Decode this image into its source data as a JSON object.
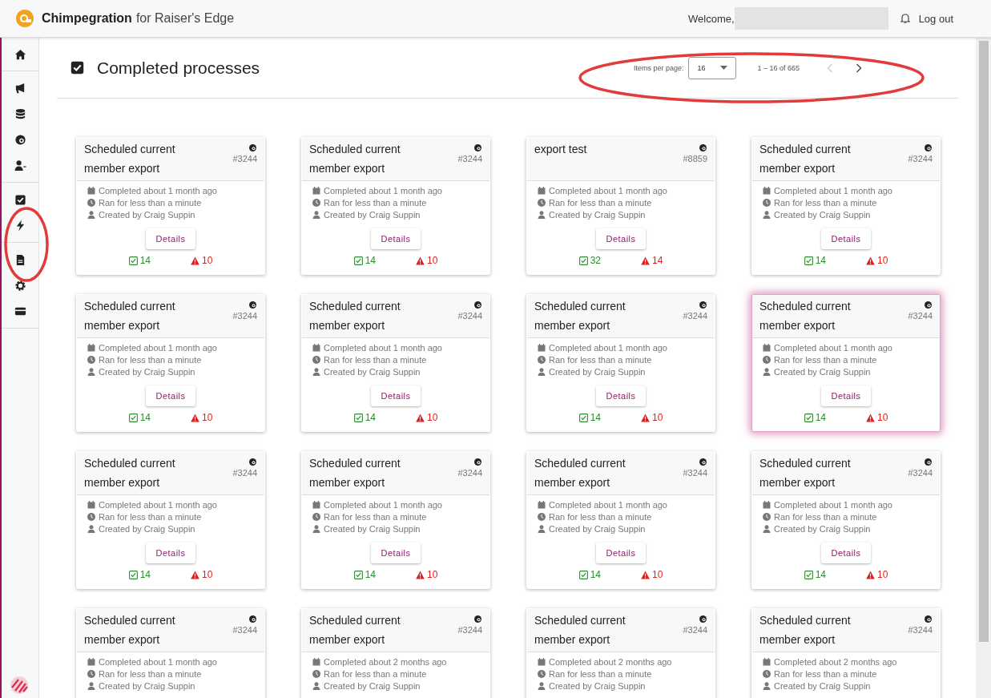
{
  "app": {
    "name": "Chimpegration",
    "suffix": "for Raiser's Edge",
    "welcome": "Welcome,",
    "logout": "Log out"
  },
  "page": {
    "title": "Completed processes"
  },
  "paginator": {
    "label": "Items per page:",
    "page_size": "16",
    "range": "1 – 16 of 665",
    "prev_disabled": true,
    "next_disabled": false
  },
  "cards": [
    {
      "title": "Scheduled current member export",
      "id": "#3244",
      "completed": "Completed about 1 month ago",
      "duration": "Ran for less than a minute",
      "creator": "Created by Craig Suppin",
      "button": "Details",
      "ok": "14",
      "warn": "10",
      "highlighted": false
    },
    {
      "title": "Scheduled current member export",
      "id": "#3244",
      "completed": "Completed about 1 month ago",
      "duration": "Ran for less than a minute",
      "creator": "Created by Craig Suppin",
      "button": "Details",
      "ok": "14",
      "warn": "10",
      "highlighted": false
    },
    {
      "title": "export test",
      "id": "#8859",
      "completed": "Completed about 1 month ago",
      "duration": "Ran for less than a minute",
      "creator": "Created by Craig Suppin",
      "button": "Details",
      "ok": "32",
      "warn": "14",
      "highlighted": false
    },
    {
      "title": "Scheduled current member export",
      "id": "#3244",
      "completed": "Completed about 1 month ago",
      "duration": "Ran for less than a minute",
      "creator": "Created by Craig Suppin",
      "button": "Details",
      "ok": "14",
      "warn": "10",
      "highlighted": false
    },
    {
      "title": "Scheduled current member export",
      "id": "#3244",
      "completed": "Completed about 1 month ago",
      "duration": "Ran for less than a minute",
      "creator": "Created by Craig Suppin",
      "button": "Details",
      "ok": "14",
      "warn": "10",
      "highlighted": false
    },
    {
      "title": "Scheduled current member export",
      "id": "#3244",
      "completed": "Completed about 1 month ago",
      "duration": "Ran for less than a minute",
      "creator": "Created by Craig Suppin",
      "button": "Details",
      "ok": "14",
      "warn": "10",
      "highlighted": false
    },
    {
      "title": "Scheduled current member export",
      "id": "#3244",
      "completed": "Completed about 1 month ago",
      "duration": "Ran for less than a minute",
      "creator": "Created by Craig Suppin",
      "button": "Details",
      "ok": "14",
      "warn": "10",
      "highlighted": false
    },
    {
      "title": "Scheduled current member export",
      "id": "#3244",
      "completed": "Completed about 1 month ago",
      "duration": "Ran for less than a minute",
      "creator": "Created by Craig Suppin",
      "button": "Details",
      "ok": "14",
      "warn": "10",
      "highlighted": true
    },
    {
      "title": "Scheduled current member export",
      "id": "#3244",
      "completed": "Completed about 1 month ago",
      "duration": "Ran for less than a minute",
      "creator": "Created by Craig Suppin",
      "button": "Details",
      "ok": "14",
      "warn": "10",
      "highlighted": false
    },
    {
      "title": "Scheduled current member export",
      "id": "#3244",
      "completed": "Completed about 1 month ago",
      "duration": "Ran for less than a minute",
      "creator": "Created by Craig Suppin",
      "button": "Details",
      "ok": "14",
      "warn": "10",
      "highlighted": false
    },
    {
      "title": "Scheduled current member export",
      "id": "#3244",
      "completed": "Completed about 1 month ago",
      "duration": "Ran for less than a minute",
      "creator": "Created by Craig Suppin",
      "button": "Details",
      "ok": "14",
      "warn": "10",
      "highlighted": false
    },
    {
      "title": "Scheduled current member export",
      "id": "#3244",
      "completed": "Completed about 1 month ago",
      "duration": "Ran for less than a minute",
      "creator": "Created by Craig Suppin",
      "button": "Details",
      "ok": "14",
      "warn": "10",
      "highlighted": false
    },
    {
      "title": "Scheduled current member export",
      "id": "#3244",
      "completed": "Completed about 1 month ago",
      "duration": "Ran for less than a minute",
      "creator": "Created by Craig Suppin",
      "highlighted": false
    },
    {
      "title": "Scheduled current member export",
      "id": "#3244",
      "completed": "Completed about 2 months ago",
      "duration": "Ran for less than a minute",
      "creator": "Created by Craig Suppin",
      "highlighted": false
    },
    {
      "title": "Scheduled current member export",
      "id": "#3244",
      "completed": "Completed about 2 months ago",
      "duration": "Ran for less than a minute",
      "creator": "Created by Craig Suppin",
      "highlighted": false
    },
    {
      "title": "Scheduled current member export",
      "id": "#3244",
      "completed": "Completed about 2 months ago",
      "duration": "Ran for less than a minute",
      "creator": "Created by Craig Suppin",
      "highlighted": false
    }
  ]
}
